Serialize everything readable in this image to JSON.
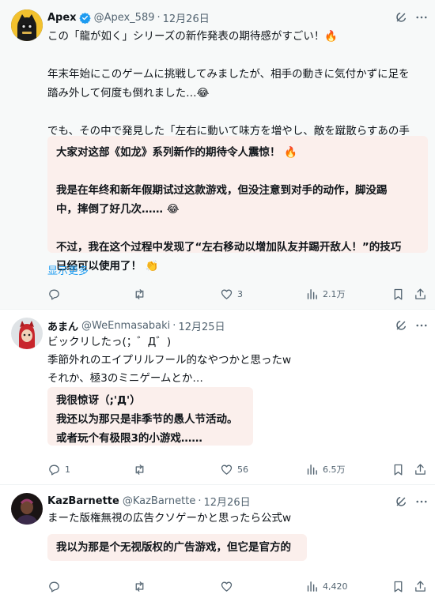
{
  "tweets": [
    {
      "name": "Apex",
      "handle": "@Apex_589",
      "date": "12月26日",
      "text": "この「龍が如く」シリーズの新作発表の期待感がすごい！🔥\n\n年末年始にこのゲームに挑戦してみましたが、相手の動きに気付かずに足を\n踏み外して何度も倒れました…😂\n\nでも、その中で発見した「左右に動いて味方を増やし、敵を蹴散らすあの手\nのゲーム！」の技はもうすでに使えるレベルです！👏",
      "translation": "大家对这部《如龙》系列新作的期待令人震惊！ 🔥\n\n我是在年终和新年假期试过这款游戏，但没注意到对手的动作，脚没踢\n中，摔倒了好几次…… 😂\n\n不过，我在这个过程中发现了“左右移动以增加队友并踢开敌人！”的技巧\n已经可以使用了！ 👏",
      "show_more": "显示更多",
      "replies": "",
      "retweets": "",
      "likes": "3",
      "views": "2.1万",
      "verified": true
    },
    {
      "name": "あまん",
      "handle": "@WeEnmasabaki",
      "date": "12月25日",
      "text": "ビックリしたっ(；゛Д゛)\n季節外れのエイプリルフール的なやつかと思ったw\nそれか、極3のミニゲームとか…",
      "translation": "我很惊讶（;'Д'）\n我还以为那只是非季节的愚人节活动。\n或者玩个有极限3的小游戏……",
      "replies": "1",
      "retweets": "",
      "likes": "56",
      "views": "6.5万"
    },
    {
      "name": "KazBarnette",
      "handle": "@KazBarnette",
      "date": "12月26日",
      "text": "まーた版権無視の広告クソゲーかと思ったら公式w",
      "translation": "我以为那是个无视版权的广告游戏，但它是官方的",
      "replies": "",
      "retweets": "",
      "likes": "",
      "views": "4,420"
    }
  ],
  "separator": "·",
  "colors": {
    "text": "#0f1419",
    "secondary": "#536471",
    "link": "#1d9bf0",
    "translation_bg": "#fbefec",
    "verified": "#1d9bf0",
    "highlight_bg": "#f7f9f9"
  },
  "icons": [
    "verified-badge-icon",
    "grok-icon",
    "more-icon",
    "reply-icon",
    "retweet-icon",
    "like-icon",
    "views-icon",
    "bookmark-icon",
    "share-icon"
  ]
}
